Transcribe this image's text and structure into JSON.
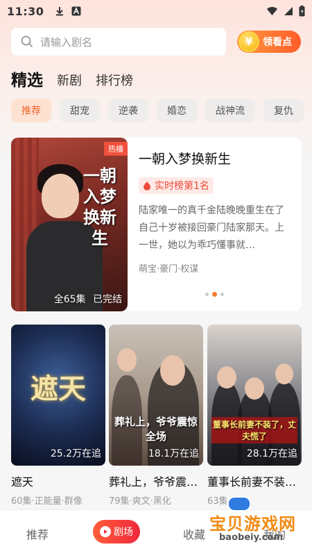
{
  "status_bar": {
    "time": "11:30"
  },
  "search": {
    "placeholder": "请输入剧名"
  },
  "coin_button": {
    "coin_symbol": "¥",
    "label": "领看点"
  },
  "main_tabs": [
    {
      "label": "精选",
      "active": true
    },
    {
      "label": "新剧",
      "active": false
    },
    {
      "label": "排行榜",
      "active": false
    }
  ],
  "categories": [
    {
      "label": "推荐",
      "active": true
    },
    {
      "label": "甜宠",
      "active": false
    },
    {
      "label": "逆袭",
      "active": false
    },
    {
      "label": "婚恋",
      "active": false
    },
    {
      "label": "战神流",
      "active": false
    },
    {
      "label": "复仇",
      "active": false
    }
  ],
  "featured": {
    "poster_title": "一朝入梦换新生",
    "hot_tag": "热播",
    "episodes": "全65集",
    "status": "已完结",
    "title": "一朝入梦换新生",
    "rank": "实时榜第1名",
    "description": "陆家唯一的真千金陆晚晚重生在了自己十岁被接回豪门陆家那天。上一世，她以为乖巧懂事就…",
    "tags": "萌宝·豪门·权谋"
  },
  "carousel": {
    "count": 3,
    "active_index": 1
  },
  "dramas": [
    {
      "poster_text": "遮天",
      "follow": "25.2万在追",
      "title": "遮天",
      "meta": "60集·正能量·群像"
    },
    {
      "poster_text": "葬礼上，爷爷震惊全场",
      "follow": "18.1万在追",
      "title": "葬礼上，爷爷震…",
      "meta": "79集·爽文·黑化"
    },
    {
      "poster_text": "董事长前妻不装了，丈夫慌了",
      "follow": "28.1万在追",
      "title": "董事长前妻不装…",
      "meta": "63集"
    }
  ],
  "bottom_nav": {
    "recommend": "推荐",
    "theater": "剧场",
    "favorites": "收藏",
    "mine": "我的"
  },
  "watermark": {
    "text": "宝贝游戏网",
    "url": "baobeiy.com"
  },
  "colors": {
    "accent": "#f57d31",
    "hot": "#f0513c",
    "nav_active": "#f0283c"
  }
}
